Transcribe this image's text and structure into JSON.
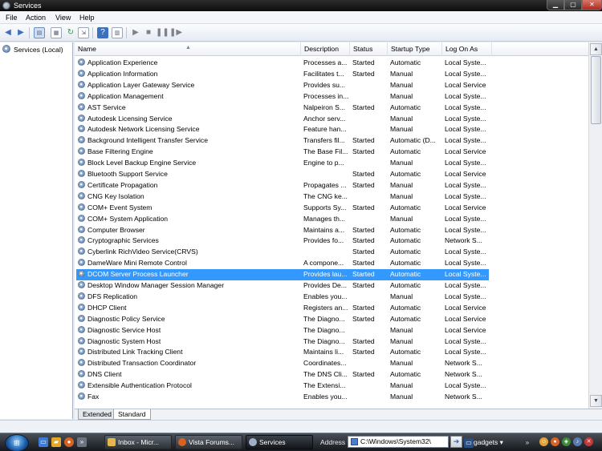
{
  "window": {
    "title": "Services"
  },
  "menu": [
    "File",
    "Action",
    "View",
    "Help"
  ],
  "tree": {
    "root_label": "Services (Local)"
  },
  "columns": {
    "name": "Name",
    "description": "Description",
    "status": "Status",
    "startup": "Startup Type",
    "logon": "Log On As"
  },
  "services": [
    [
      "Application Experience",
      "Processes a...",
      "Started",
      "Automatic",
      "Local Syste..."
    ],
    [
      "Application Information",
      "Facilitates t...",
      "Started",
      "Manual",
      "Local Syste..."
    ],
    [
      "Application Layer Gateway Service",
      "Provides su...",
      "",
      "Manual",
      "Local Service"
    ],
    [
      "Application Management",
      "Processes in...",
      "",
      "Manual",
      "Local Syste..."
    ],
    [
      "AST Service",
      "Nalpeiron S...",
      "Started",
      "Automatic",
      "Local Syste..."
    ],
    [
      "Autodesk Licensing Service",
      "Anchor serv...",
      "",
      "Manual",
      "Local Syste..."
    ],
    [
      "Autodesk Network Licensing Service",
      "Feature han...",
      "",
      "Manual",
      "Local Syste..."
    ],
    [
      "Background Intelligent Transfer Service",
      "Transfers fil...",
      "Started",
      "Automatic (D...",
      "Local Syste..."
    ],
    [
      "Base Filtering Engine",
      "The Base Fil...",
      "Started",
      "Automatic",
      "Local Service"
    ],
    [
      "Block Level Backup Engine Service",
      "Engine to p...",
      "",
      "Manual",
      "Local Syste..."
    ],
    [
      "Bluetooth Support Service",
      "",
      "Started",
      "Automatic",
      "Local Service"
    ],
    [
      "Certificate Propagation",
      "Propagates ...",
      "Started",
      "Manual",
      "Local Syste..."
    ],
    [
      "CNG Key Isolation",
      "The CNG ke...",
      "",
      "Manual",
      "Local Syste..."
    ],
    [
      "COM+ Event System",
      "Supports Sy...",
      "Started",
      "Automatic",
      "Local Service"
    ],
    [
      "COM+ System Application",
      "Manages th...",
      "",
      "Manual",
      "Local Syste..."
    ],
    [
      "Computer Browser",
      "Maintains a...",
      "Started",
      "Automatic",
      "Local Syste..."
    ],
    [
      "Cryptographic Services",
      "Provides fo...",
      "Started",
      "Automatic",
      "Network S..."
    ],
    [
      "Cyberlink RichVideo Service(CRVS)",
      "",
      "Started",
      "Automatic",
      "Local Syste..."
    ],
    [
      "DameWare Mini Remote Control",
      "A compone...",
      "Started",
      "Automatic",
      "Local Syste..."
    ],
    [
      "DCOM Server Process Launcher",
      "Provides lau...",
      "Started",
      "Automatic",
      "Local Syste..."
    ],
    [
      "Desktop Window Manager Session Manager",
      "Provides De...",
      "Started",
      "Automatic",
      "Local Syste..."
    ],
    [
      "DFS Replication",
      "Enables you...",
      "",
      "Manual",
      "Local Syste..."
    ],
    [
      "DHCP Client",
      "Registers an...",
      "Started",
      "Automatic",
      "Local Service"
    ],
    [
      "Diagnostic Policy Service",
      "The Diagno...",
      "Started",
      "Automatic",
      "Local Service"
    ],
    [
      "Diagnostic Service Host",
      "The Diagno...",
      "",
      "Manual",
      "Local Service"
    ],
    [
      "Diagnostic System Host",
      "The Diagno...",
      "Started",
      "Manual",
      "Local Syste..."
    ],
    [
      "Distributed Link Tracking Client",
      "Maintains li...",
      "Started",
      "Automatic",
      "Local Syste..."
    ],
    [
      "Distributed Transaction Coordinator",
      "Coordinates...",
      "",
      "Manual",
      "Network S..."
    ],
    [
      "DNS Client",
      "The DNS Cli...",
      "Started",
      "Automatic",
      "Network S..."
    ],
    [
      "Extensible Authentication Protocol",
      "The Extensi...",
      "",
      "Manual",
      "Local Syste..."
    ],
    [
      "Fax",
      "Enables you...",
      "",
      "Manual",
      "Network S..."
    ]
  ],
  "selected_service": "DCOM Server Process Launcher",
  "tabs": [
    "Extended",
    "Standard"
  ],
  "active_tab": "Standard",
  "taskbar": {
    "tasks": [
      "Inbox - Micr...",
      "Vista Forums...",
      "Services"
    ],
    "active_task": "Services",
    "address_label": "Address",
    "address_value": "C:\\Windows\\System32\\",
    "gadgets_label": "gadgets"
  },
  "colors": {
    "selection": "#3399ff",
    "titlebar": "#1a1a1a",
    "taskbar": "#2a2f35"
  },
  "icons": {
    "service_row": "gear-icon",
    "toolbar": [
      "back-icon",
      "forward-icon",
      "console-tree-icon",
      "properties-icon",
      "refresh-icon",
      "export-icon",
      "help-icon",
      "mmc-icon",
      "play-icon",
      "stop-icon",
      "pause-icon",
      "restart-icon"
    ]
  }
}
